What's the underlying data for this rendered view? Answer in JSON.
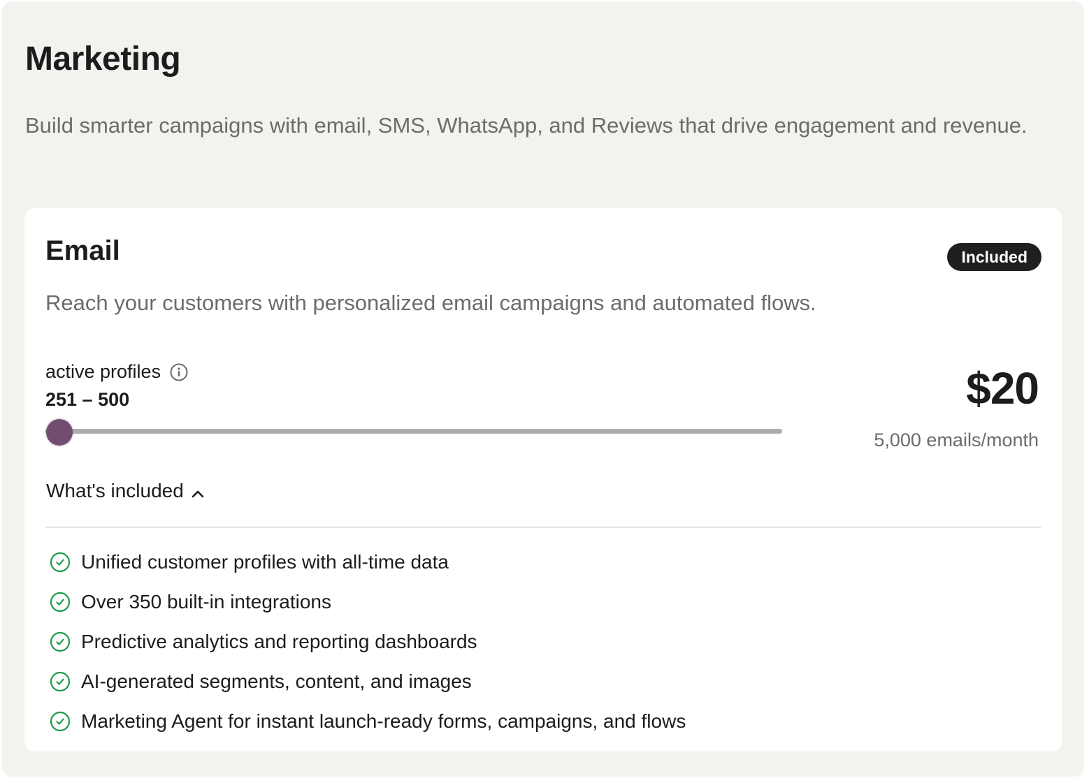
{
  "section": {
    "title": "Marketing",
    "description": "Build smarter campaigns with email, SMS, WhatsApp, and Reviews that drive engagement and revenue."
  },
  "email_card": {
    "title": "Email",
    "badge": "Included",
    "description": "Reach your customers with personalized email campaigns and automated flows.",
    "profiles_label": "active profiles",
    "profiles_info_icon": "info-icon",
    "profiles_range": "251 – 500",
    "slider_level": 0,
    "price": "$20",
    "price_sub": "5,000 emails/month",
    "whats_included_label": "What's included",
    "whats_included_icon": "chevron-up-icon",
    "features": [
      "Unified customer profiles with all-time data",
      "Over 350 built-in integrations",
      "Predictive analytics and reporting dashboards",
      "AI-generated segments, content, and images",
      "Marketing Agent for instant launch-ready forms, campaigns, and flows"
    ],
    "feature_icon": "check-circle-icon"
  },
  "colors": {
    "page_background": "#f3f2ef",
    "card_background": "#ffffff",
    "badge_background": "#1f1f1f",
    "slider_thumb": "#714d72",
    "slider_track": "#acacac",
    "check_green": "#1f9a4e",
    "muted_text": "#6d6c69"
  }
}
